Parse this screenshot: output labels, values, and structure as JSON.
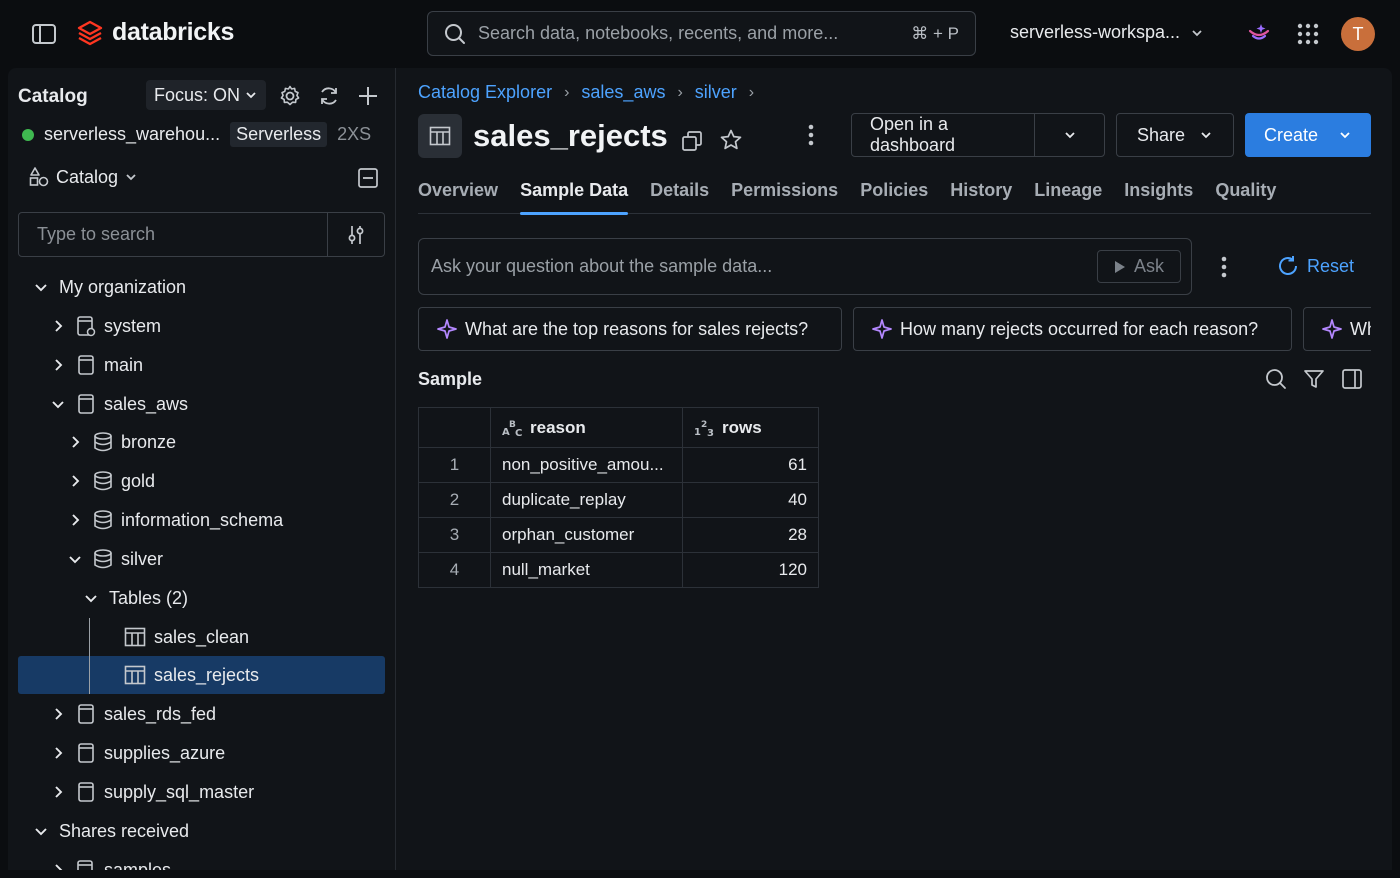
{
  "topbar": {
    "brand": "databricks",
    "search_placeholder": "Search data, notebooks, recents, and more...",
    "search_shortcut": "⌘ + P",
    "workspace": "serverless-workspa...",
    "avatar_initial": "T"
  },
  "left": {
    "title": "Catalog",
    "focus": "Focus: ON",
    "warehouse": "serverless_warehou...",
    "warehouse_type": "Serverless",
    "warehouse_size": "2XS",
    "catalog_selector": "Catalog",
    "search_placeholder": "Type to search",
    "tree": {
      "my_org": "My organization",
      "system": "system",
      "main": "main",
      "sales_aws": "sales_aws",
      "bronze": "bronze",
      "gold": "gold",
      "information_schema": "information_schema",
      "silver": "silver",
      "tables": "Tables (2)",
      "sales_clean": "sales_clean",
      "sales_rejects": "sales_rejects",
      "sales_rds_fed": "sales_rds_fed",
      "supplies_azure": "supplies_azure",
      "supply_sql_master": "supply_sql_master",
      "shares_received": "Shares received",
      "samples": "samples"
    }
  },
  "main": {
    "breadcrumb": [
      "Catalog Explorer",
      "sales_aws",
      "silver"
    ],
    "title": "sales_rejects",
    "open_dashboard": "Open in a dashboard",
    "share": "Share",
    "create": "Create",
    "tabs": [
      "Overview",
      "Sample Data",
      "Details",
      "Permissions",
      "Policies",
      "History",
      "Lineage",
      "Insights",
      "Quality"
    ],
    "active_tab": "Sample Data",
    "ask_placeholder": "Ask your question about the sample data...",
    "ask_button": "Ask",
    "reset": "Reset",
    "chips": [
      "What are the top reasons for sales rejects?",
      "How many rejects occurred for each reason?",
      "Wh"
    ],
    "sample_title": "Sample",
    "columns": [
      {
        "name": "reason",
        "type": "ABC"
      },
      {
        "name": "rows",
        "type": "123"
      }
    ],
    "rows": [
      {
        "idx": "1",
        "reason": "non_positive_amou...",
        "rows": "61"
      },
      {
        "idx": "2",
        "reason": "duplicate_replay",
        "rows": "40"
      },
      {
        "idx": "3",
        "reason": "orphan_customer",
        "rows": "28"
      },
      {
        "idx": "4",
        "reason": "null_market",
        "rows": "120"
      }
    ]
  },
  "colors": {
    "accent": "#4da3ff",
    "primary_button": "#2b7de0",
    "selected_row": "#173a65",
    "status_green": "#3fb950",
    "brand_red": "#ff3621"
  }
}
